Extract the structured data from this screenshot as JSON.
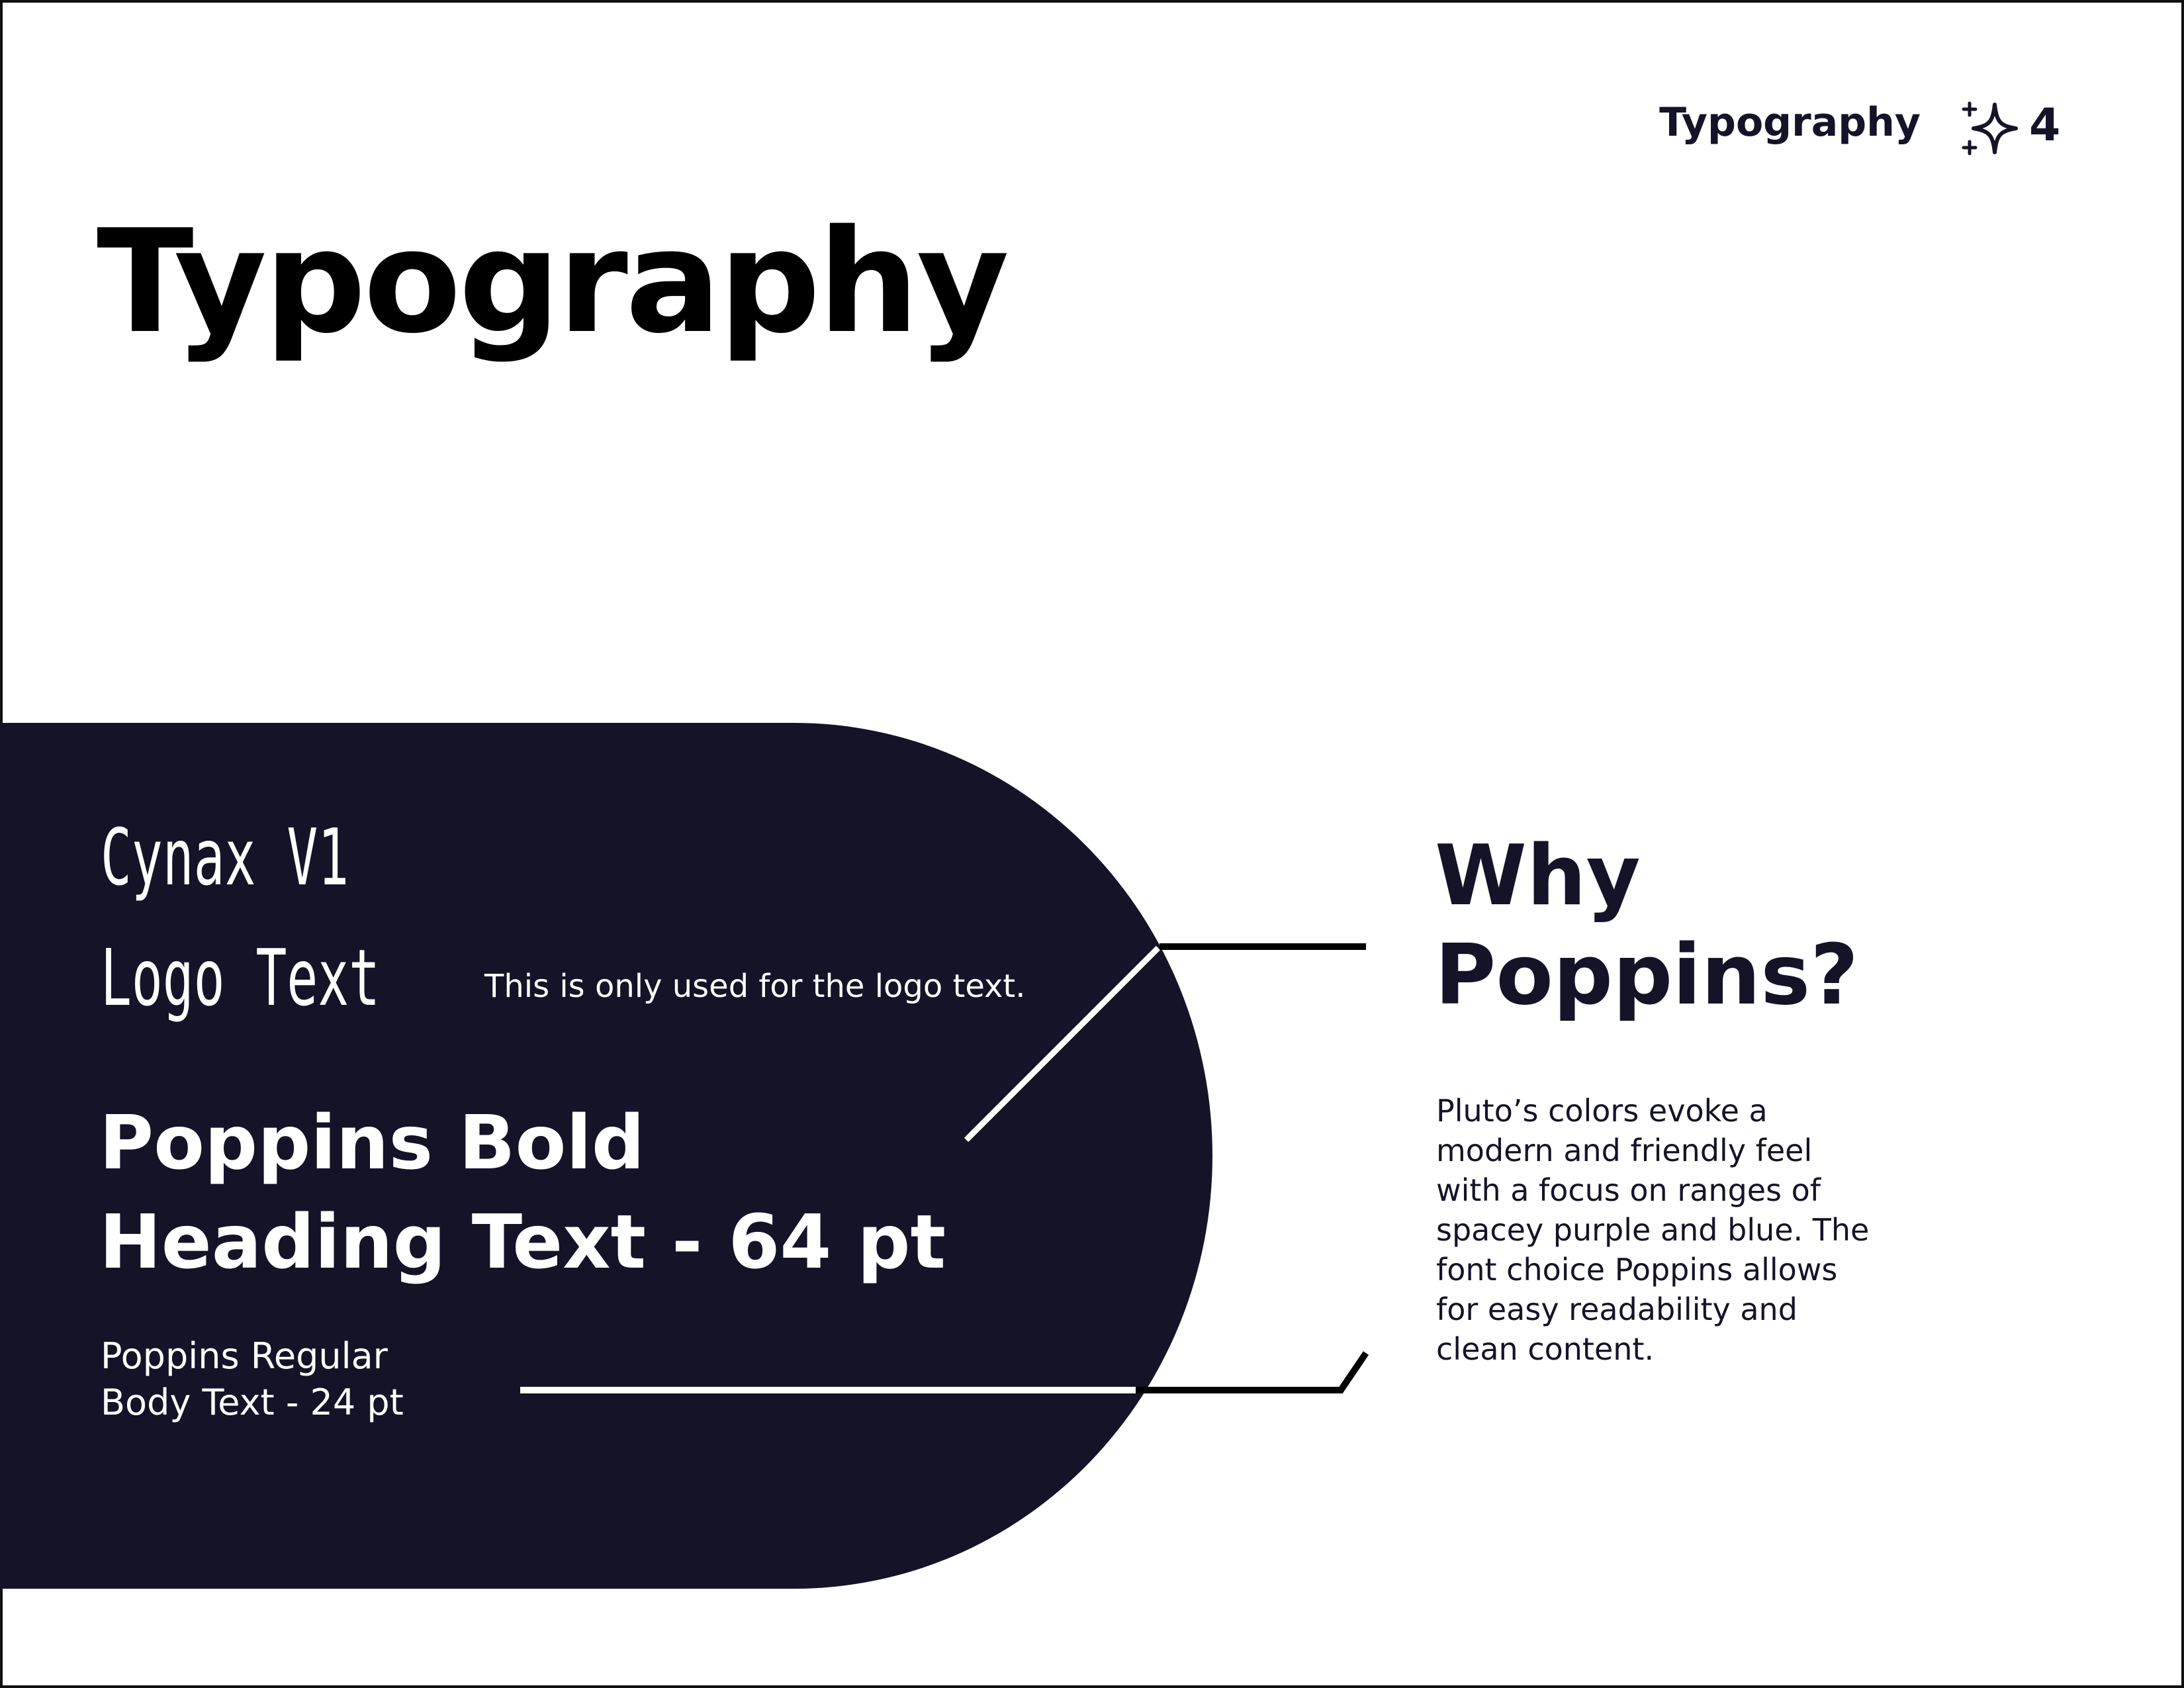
{
  "header": {
    "section_label": "Typography",
    "page_number": "4",
    "icon": "sparkle-icon"
  },
  "title": "Typography",
  "panel": {
    "logo_font_name": "Cynax V1",
    "logo_text_label": "Logo Text",
    "logo_note": "This is only used for the logo text.",
    "heading_sample_lines": [
      "Poppins Bold",
      "Heading Text - 64 pt"
    ],
    "body_sample_lines": [
      "Poppins Regular",
      "Body Text - 24 pt"
    ]
  },
  "side": {
    "heading_lines": [
      "Why",
      "Poppins?"
    ],
    "paragraph_lines": [
      "Pluto’s colors evoke a",
      "modern and friendly feel",
      "with a focus on ranges of",
      "spacey purple and blue. The",
      "font choice Poppins allows",
      "for easy readability and",
      "clean content."
    ]
  },
  "colors": {
    "navy_panel": "#141328",
    "text_dark": "#141328",
    "title_black": "#000000",
    "white": "#ffffff"
  }
}
